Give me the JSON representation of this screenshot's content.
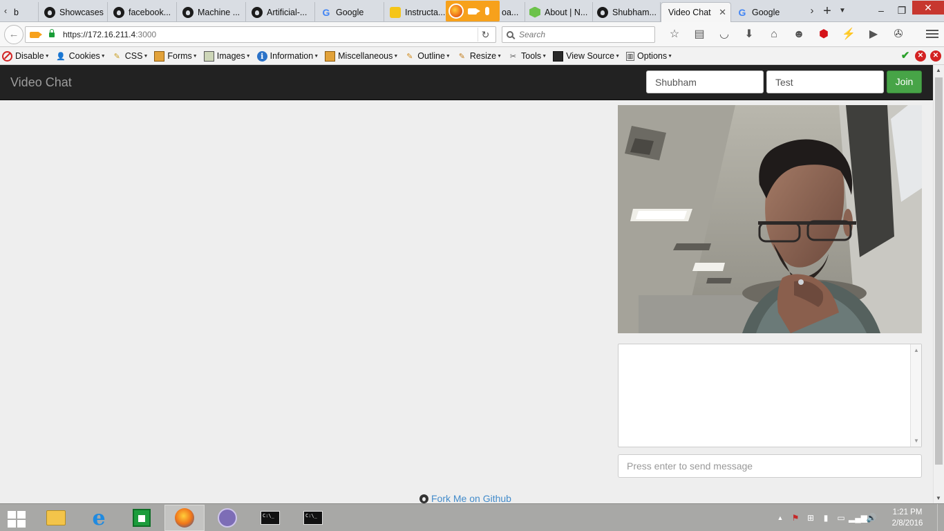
{
  "browser": {
    "tabs": [
      {
        "label": "b",
        "icon": "scroll-left-icon"
      },
      {
        "label": "Showcases",
        "icon": "github-icon"
      },
      {
        "label": "facebook...",
        "icon": "github-icon"
      },
      {
        "label": "Machine ...",
        "icon": "github-icon"
      },
      {
        "label": "Artificial-...",
        "icon": "github-icon"
      },
      {
        "label": "Google",
        "icon": "google-icon"
      },
      {
        "label": "Instructa...",
        "icon": "instructables-icon"
      },
      {
        "label": "oa...",
        "icon": "media-sharing-indicator"
      },
      {
        "label": "About | N...",
        "icon": "nodejs-icon"
      },
      {
        "label": "Shubham...",
        "icon": "github-icon"
      },
      {
        "label": "Video Chat",
        "icon": "none",
        "active": true
      },
      {
        "label": "Google",
        "icon": "google-icon"
      }
    ],
    "url": {
      "host": "https://172.16.211.4",
      "port": ":3000"
    },
    "search_placeholder": "Search",
    "devbar": [
      {
        "label": "Disable",
        "icon": "disable-icon"
      },
      {
        "label": "Cookies",
        "icon": "cookies-icon"
      },
      {
        "label": "CSS",
        "icon": "css-icon"
      },
      {
        "label": "Forms",
        "icon": "forms-icon"
      },
      {
        "label": "Images",
        "icon": "images-icon"
      },
      {
        "label": "Information",
        "icon": "information-icon"
      },
      {
        "label": "Miscellaneous",
        "icon": "miscellaneous-icon"
      },
      {
        "label": "Outline",
        "icon": "outline-icon"
      },
      {
        "label": "Resize",
        "icon": "resize-icon"
      },
      {
        "label": "Tools",
        "icon": "tools-icon"
      },
      {
        "label": "View Source",
        "icon": "view-source-icon"
      },
      {
        "label": "Options",
        "icon": "options-icon"
      }
    ]
  },
  "app": {
    "brand": "Video Chat",
    "name_value": "Shubham",
    "room_value": "Test",
    "join_label": "Join",
    "message_placeholder": "Press enter to send message",
    "fork_label": "Fork Me on Github"
  },
  "taskbar": {
    "apps": [
      "file-explorer",
      "internet-explorer",
      "windows-store",
      "firefox",
      "bittorrent",
      "command-prompt",
      "command-prompt"
    ],
    "time": "1:21 PM",
    "date": "2/8/2016"
  },
  "colors": {
    "app_navbar": "#222222",
    "join_button": "#47a447",
    "sharing_indicator": "#f7a11b",
    "link": "#428bca"
  }
}
